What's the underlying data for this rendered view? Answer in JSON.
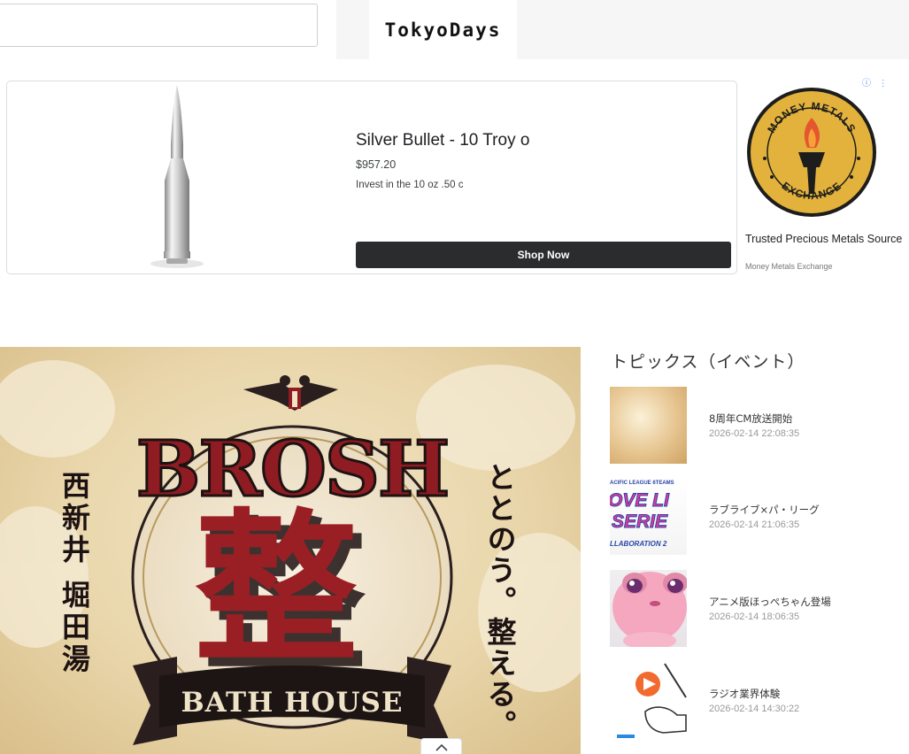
{
  "header": {
    "search_placeholder": "",
    "logo_text": "TokyoDays"
  },
  "ad": {
    "product_title": "Silver Bullet - 10 Troy o",
    "price": "$957.20",
    "description": "Invest in the 10 oz .50 c",
    "cta_label": "Shop Now",
    "advertiser_logo_top": "MONEY METALS",
    "advertiser_logo_bottom": "EXCHANGE",
    "advertiser_headline": "Trusted Precious Metals Source",
    "advertiser_name": "Money Metals Exchange",
    "adchoices_label": "ⓘ ⋮"
  },
  "hero": {
    "brand": "BROSH",
    "kanji_big": "整",
    "banner": "BATH HOUSE",
    "left_vertical": "西新井 堀田湯",
    "right_vertical": "ととのう。整える。"
  },
  "topics": {
    "heading": "トピックス（イベント）",
    "items": [
      {
        "title": "8周年CM放送開始",
        "date": "2026-02-14 22:08:35"
      },
      {
        "title": "ラブライブ×パ・リーグ",
        "date": "2026-02-14 21:06:35"
      },
      {
        "title": "アニメ版ほっぺちゃん登場",
        "date": "2026-02-14 18:06:35"
      },
      {
        "title": "ラジオ業界体験",
        "date": "2026-02-14 14:30:22"
      }
    ],
    "thumb2_text_top": "ACIFIC LEAGUE 6TEAMS",
    "thumb2_text_mid": "OVE LI",
    "thumb2_text_mid2": "SERIE",
    "thumb2_text_bottom": "LLABORATION 2"
  },
  "scroll_top_icon": "chevron-up-icon",
  "colors": {
    "brand_red": "#8e1c22",
    "shop_button": "#2b2c2e",
    "mme_gold": "#d9a62a"
  }
}
